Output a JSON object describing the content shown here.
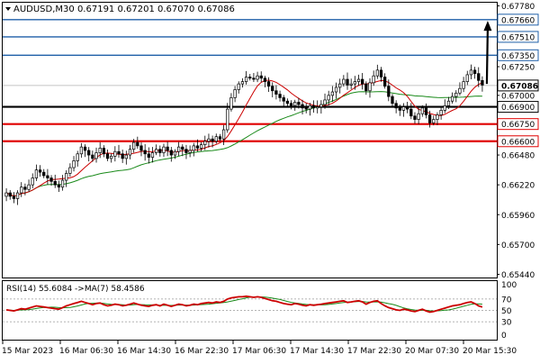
{
  "colors": {
    "background": "#ffffff",
    "frame": "#000000",
    "up_candle": "#ffffff",
    "down_candle": "#000000",
    "ma_fast": "#cc0000",
    "ma_slow": "#1a8a1a",
    "level_blue": "#1f5fa8",
    "level_red": "#e00000",
    "level_black": "#000000",
    "arrow": "#000000",
    "rsi_line": "#cc0000",
    "rsi_ma": "#1a8a1a",
    "rsi_levels": "#9a9a9a",
    "price_label_bg": "#ffffff",
    "current_price_bg": "#ffffff"
  },
  "chart_data": [
    {
      "type": "candlestick",
      "title": "AUDUSD,M30  0.67191 0.67201 0.67070 0.67086",
      "symbol_header": {
        "symbol": "AUDUSD,M30",
        "open": "0.67191",
        "high": "0.67201",
        "low": "0.67070",
        "close": "0.67086"
      },
      "ylim": [
        0.6542,
        0.678
      ],
      "y_ticks": [
        "0.67780",
        "0.67660",
        "0.67510",
        "0.67350",
        "0.67250",
        "0.67086",
        "0.67000",
        "0.66900",
        "0.66750",
        "0.66600",
        "0.66480",
        "0.66220",
        "0.65960",
        "0.65700",
        "0.65440"
      ],
      "horizontal_levels": [
        {
          "price": 0.6766,
          "label": "0.67660",
          "color_key": "level_blue",
          "style": "thin"
        },
        {
          "price": 0.6751,
          "label": "0.67510",
          "color_key": "level_blue",
          "style": "thin"
        },
        {
          "price": 0.6735,
          "label": "0.67350",
          "color_key": "level_blue",
          "style": "thin"
        },
        {
          "price": 0.669,
          "label": "0.66900",
          "color_key": "level_black",
          "style": "thick"
        },
        {
          "price": 0.6675,
          "label": "0.66750",
          "color_key": "level_red",
          "style": "thick"
        },
        {
          "price": 0.666,
          "label": "0.66600",
          "color_key": "level_red",
          "style": "thick"
        }
      ],
      "current_price": 0.67086,
      "current_price_label": "0.67086",
      "arrow": {
        "from_price": 0.671,
        "to_price": 0.6765,
        "direction": "up"
      },
      "closes": [
        0.6615,
        0.6612,
        0.661,
        0.6615,
        0.662,
        0.6618,
        0.6622,
        0.6628,
        0.6635,
        0.6633,
        0.663,
        0.6628,
        0.6625,
        0.6622,
        0.662,
        0.6626,
        0.6632,
        0.6637,
        0.6643,
        0.6649,
        0.6655,
        0.6652,
        0.6648,
        0.6645,
        0.665,
        0.6654,
        0.6649,
        0.6645,
        0.6647,
        0.6651,
        0.6649,
        0.6645,
        0.6648,
        0.6653,
        0.6659,
        0.6656,
        0.6652,
        0.6649,
        0.6646,
        0.665,
        0.6653,
        0.665,
        0.6655,
        0.6652,
        0.6648,
        0.6651,
        0.6655,
        0.6653,
        0.665,
        0.6652,
        0.6656,
        0.6654,
        0.6657,
        0.666,
        0.6662,
        0.666,
        0.6664,
        0.6662,
        0.667,
        0.6688,
        0.6698,
        0.6705,
        0.671,
        0.6712,
        0.6716,
        0.6715,
        0.6714,
        0.6717,
        0.6715,
        0.6712,
        0.6708,
        0.6704,
        0.6701,
        0.6698,
        0.6695,
        0.6693,
        0.6691,
        0.6694,
        0.6692,
        0.6689,
        0.6688,
        0.6691,
        0.6689,
        0.669,
        0.6692,
        0.6696,
        0.67,
        0.6703,
        0.6707,
        0.671,
        0.6714,
        0.6709,
        0.671,
        0.6712,
        0.6714,
        0.671,
        0.6704,
        0.6711,
        0.6717,
        0.6722,
        0.6716,
        0.6708,
        0.6699,
        0.6693,
        0.6689,
        0.6687,
        0.669,
        0.6688,
        0.6682,
        0.6679,
        0.6684,
        0.6689,
        0.6683,
        0.6676,
        0.6679,
        0.6683,
        0.6687,
        0.6691,
        0.6695,
        0.6699,
        0.6702,
        0.6706,
        0.6712,
        0.6718,
        0.6722,
        0.6719,
        0.6713,
        0.6709
      ],
      "ma_fast_closes_window": 9,
      "ma_slow_closes_window": 34,
      "x_ticks": [
        "15 Mar 2023",
        "16 Mar 06:30",
        "16 Mar 14:30",
        "16 Mar 22:30",
        "17 Mar 06:30",
        "17 Mar 14:30",
        "17 Mar 22:30",
        "20 Mar 07:30",
        "20 Mar 15:30"
      ]
    },
    {
      "type": "line",
      "title": "RSI(14) 55.6084  ->MA(7) 58.4586",
      "indicator_label": "RSI(14) 55.6084",
      "ma_label": "->MA(7) 58.4586",
      "ylim": [
        0,
        100
      ],
      "y_ticks": [
        "100",
        "70",
        "50",
        "30",
        "0"
      ],
      "levels": [
        70,
        50,
        30
      ],
      "rsi_values": [
        51,
        50,
        49,
        51,
        53,
        52,
        54,
        56,
        58,
        57,
        56,
        55,
        54,
        53,
        52,
        55,
        58,
        60,
        62,
        64,
        66,
        64,
        62,
        60,
        62,
        63,
        60,
        58,
        59,
        61,
        60,
        58,
        59,
        61,
        63,
        61,
        59,
        58,
        57,
        59,
        60,
        58,
        61,
        59,
        57,
        59,
        61,
        60,
        58,
        59,
        61,
        60,
        62,
        63,
        64,
        63,
        65,
        64,
        66,
        70,
        72,
        73,
        74,
        74,
        75,
        74,
        73,
        74,
        73,
        71,
        69,
        67,
        66,
        64,
        62,
        61,
        60,
        62,
        61,
        59,
        58,
        60,
        59,
        60,
        61,
        62,
        63,
        64,
        65,
        66,
        67,
        64,
        65,
        66,
        67,
        65,
        61,
        64,
        66,
        67,
        62,
        58,
        55,
        53,
        51,
        50,
        52,
        51,
        49,
        48,
        50,
        52,
        49,
        47,
        48,
        50,
        52,
        54,
        56,
        58,
        59,
        60,
        62,
        64,
        65,
        62,
        58,
        56
      ]
    }
  ]
}
